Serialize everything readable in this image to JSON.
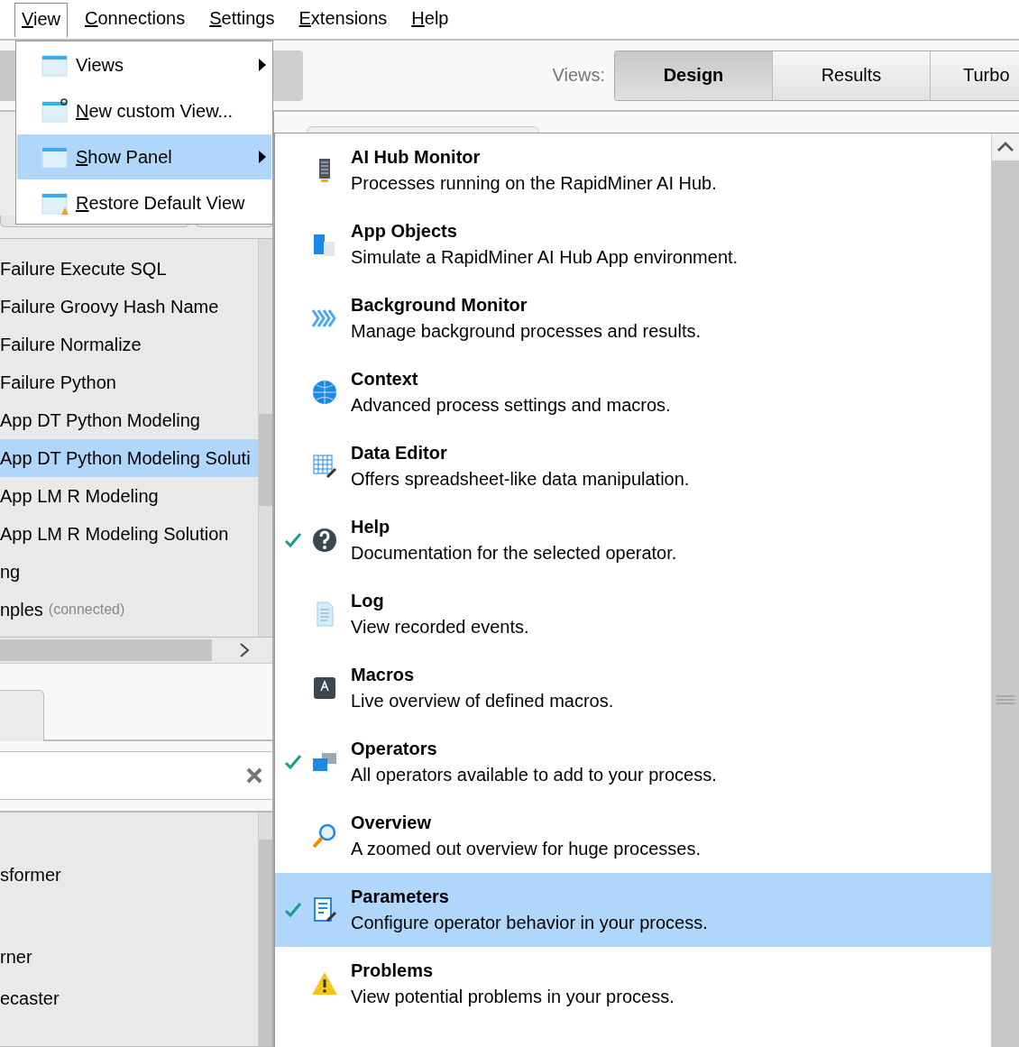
{
  "menubar": [
    {
      "label": "View",
      "mnemonic_underlined": true,
      "selected": true
    },
    {
      "label": "Connections",
      "mnemonic_underlined": true,
      "selected": false
    },
    {
      "label": "Settings",
      "mnemonic_underlined": true,
      "selected": false
    },
    {
      "label": "Extensions",
      "mnemonic_underlined": true,
      "selected": false
    },
    {
      "label": "Help",
      "mnemonic_underlined": true,
      "selected": false
    }
  ],
  "view_menu": [
    {
      "label": "Views",
      "mnemonic_underlined": false,
      "has_submenu": true,
      "selected": false
    },
    {
      "label": "New custom View...",
      "mnemonic_underlined": true,
      "has_submenu": false,
      "selected": false
    },
    {
      "label": "Show Panel",
      "mnemonic_underlined": true,
      "has_submenu": true,
      "selected": true
    },
    {
      "label": "Restore Default View",
      "mnemonic_underlined": true,
      "has_submenu": false,
      "selected": false
    }
  ],
  "perspectives": {
    "label": "Views:",
    "tabs": [
      {
        "label": "Design",
        "selected": true
      },
      {
        "label": "Results",
        "selected": false
      },
      {
        "label": "Turbo",
        "selected": false
      }
    ]
  },
  "repository_list": [
    {
      "label": "Failure Execute SQL",
      "selected": false
    },
    {
      "label": "Failure Groovy Hash Name",
      "selected": false
    },
    {
      "label": "Failure Normalize",
      "selected": false
    },
    {
      "label": "Failure Python",
      "selected": false
    },
    {
      "label": "App DT Python Modeling",
      "selected": false
    },
    {
      "label": "App DT Python Modeling Soluti",
      "selected": true
    },
    {
      "label": "App LM R Modeling",
      "selected": false
    },
    {
      "label": "App LM R Modeling Solution",
      "selected": false
    },
    {
      "label": "ng",
      "selected": false
    },
    {
      "label": "nples",
      "status": "(connected)",
      "selected": false
    }
  ],
  "operator_list": [
    {
      "label": "sformer"
    },
    {
      "label": "rner"
    },
    {
      "label": "ecaster"
    }
  ],
  "show_panel_menu": [
    {
      "title": "AI Hub Monitor",
      "description": "Processes running on the RapidMiner AI Hub.",
      "checked": false,
      "selected": false
    },
    {
      "title": "App Objects",
      "description": "Simulate a RapidMiner AI Hub App environment.",
      "checked": false,
      "selected": false
    },
    {
      "title": "Background Monitor",
      "description": "Manage background processes and results.",
      "checked": false,
      "selected": false
    },
    {
      "title": "Context",
      "description": "Advanced process settings and macros.",
      "checked": false,
      "selected": false
    },
    {
      "title": "Data Editor",
      "description": "Offers spreadsheet-like data manipulation.",
      "checked": false,
      "selected": false
    },
    {
      "title": "Help",
      "description": "Documentation for the selected operator.",
      "checked": true,
      "selected": false
    },
    {
      "title": "Log",
      "description": "View recorded events.",
      "checked": false,
      "selected": false
    },
    {
      "title": "Macros",
      "description": "Live overview of defined macros.",
      "checked": false,
      "selected": false
    },
    {
      "title": "Operators",
      "description": "All operators available to add to your process.",
      "checked": true,
      "selected": false
    },
    {
      "title": "Overview",
      "description": "A zoomed out overview for huge processes.",
      "checked": false,
      "selected": false
    },
    {
      "title": "Parameters",
      "description": "Configure operator behavior in your process.",
      "checked": true,
      "selected": true
    },
    {
      "title": "Problems",
      "description": "View potential problems in your process.",
      "checked": false,
      "selected": false
    }
  ]
}
